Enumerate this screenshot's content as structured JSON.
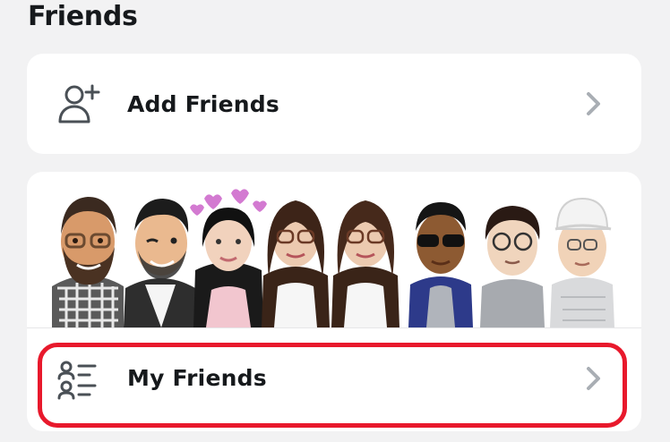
{
  "section": {
    "title": "Friends"
  },
  "add_friends": {
    "label": "Add Friends",
    "icon": "add-user-icon"
  },
  "my_friends": {
    "label": "My Friends",
    "icon": "friends-list-icon"
  },
  "colors": {
    "background": "#f2f2f3",
    "card": "#ffffff",
    "text": "#16191c",
    "chevron": "#a9aeb4",
    "highlight": "#e8192c"
  },
  "bitmojis": [
    {
      "name": "bearded-man"
    },
    {
      "name": "winking-man"
    },
    {
      "name": "woman-with-hearts"
    },
    {
      "name": "woman-glasses-1"
    },
    {
      "name": "woman-glasses-2"
    },
    {
      "name": "man-sunglasses"
    },
    {
      "name": "boy-glasses"
    },
    {
      "name": "man-cap"
    }
  ]
}
